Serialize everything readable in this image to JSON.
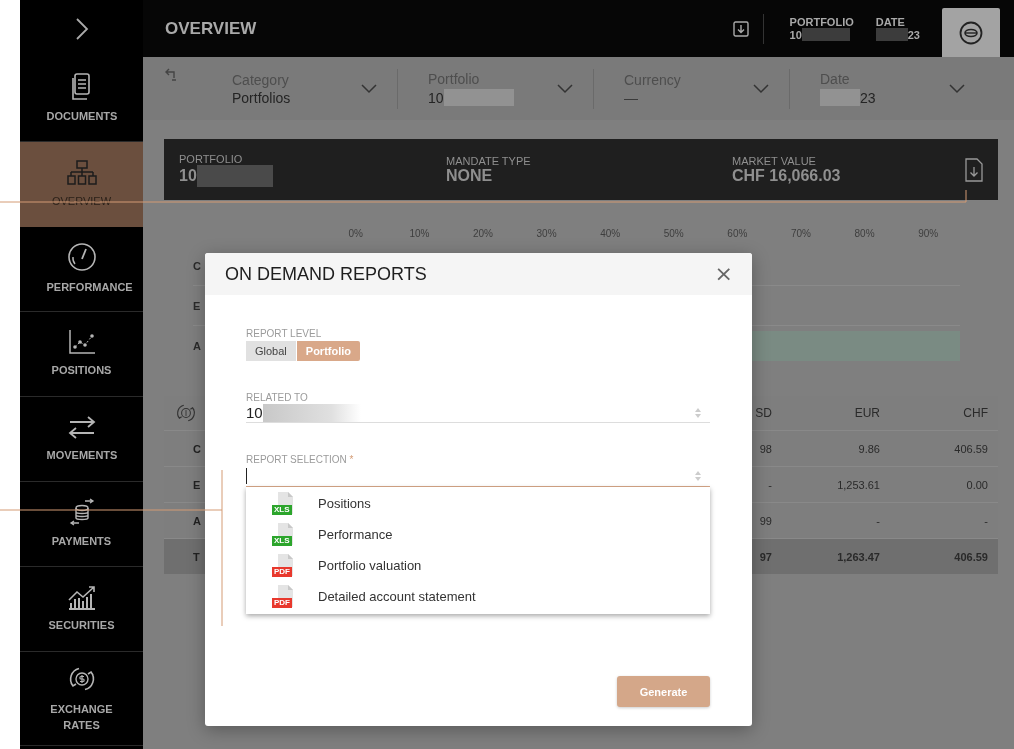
{
  "sidebar": {
    "items": [
      {
        "label": "DOCUMENTS",
        "selected": false
      },
      {
        "label": "OVERVIEW",
        "selected": true
      },
      {
        "label": "PERFORMANCE",
        "selected": false
      },
      {
        "label": "POSITIONS",
        "selected": false
      },
      {
        "label": "MOVEMENTS",
        "selected": false
      },
      {
        "label": "PAYMENTS",
        "selected": false
      },
      {
        "label": "SECURITIES",
        "selected": false
      },
      {
        "label": "EXCHANGE RATES",
        "selected": false
      }
    ]
  },
  "header": {
    "title": "OVERVIEW",
    "portfolio_label": "PORTFOLIO",
    "portfolio_value": "10",
    "date_label": "DATE",
    "date_value": "23"
  },
  "filters": [
    {
      "label": "Category",
      "value": "Portfolios",
      "redacted_before": false,
      "redacted_after": false
    },
    {
      "label": "Portfolio",
      "value": "10",
      "redacted_before": false,
      "redacted_after": true
    },
    {
      "label": "Currency",
      "placeholder": "—",
      "redacted_before": false,
      "redacted_after": false
    },
    {
      "label": "Date",
      "value": "23",
      "redacted_before": true,
      "redacted_after": false
    }
  ],
  "summary": {
    "portfolio_label": "PORTFOLIO",
    "portfolio_value": "10",
    "mandate_label": "MANDATE TYPE",
    "mandate_value": "NONE",
    "market_label": "MARKET VALUE",
    "market_value": "CHF 16,066.03"
  },
  "allocation": {
    "ticks": [
      "0%",
      "10%",
      "20%",
      "30%",
      "40%",
      "50%",
      "60%",
      "70%",
      "80%",
      "90%"
    ],
    "rows": [
      {
        "label": "C",
        "bar": false
      },
      {
        "label": "E",
        "bar": false
      },
      {
        "label": "A",
        "bar": true
      }
    ]
  },
  "table": {
    "columns": [
      "SD",
      "EUR",
      "CHF"
    ],
    "rows": [
      {
        "label": "C",
        "cells": [
          "98",
          "9.86",
          "406.59"
        ],
        "total": false
      },
      {
        "label": "E",
        "cells": [
          "-",
          "1,253.61",
          "0.00"
        ],
        "total": false
      },
      {
        "label": "A",
        "cells": [
          "99",
          "-",
          "-"
        ],
        "total": false
      },
      {
        "label": "T",
        "cells": [
          "97",
          "1,263.47",
          "406.59"
        ],
        "total": true
      }
    ]
  },
  "modal": {
    "title": "ON DEMAND REPORTS",
    "close": "×",
    "report_level": {
      "label": "REPORT LEVEL",
      "options": [
        {
          "label": "Global",
          "selected": false
        },
        {
          "label": "Portfolio",
          "selected": true
        }
      ]
    },
    "related_to": {
      "label": "RELATED TO",
      "value": "10"
    },
    "report_selection": {
      "label": "REPORT SELECTION",
      "required_mark": "*",
      "options": [
        {
          "label": "Positions",
          "kind": "xls",
          "badge": "XLS"
        },
        {
          "label": "Performance",
          "kind": "xls",
          "badge": "XLS"
        },
        {
          "label": "Portfolio valuation",
          "kind": "pdf",
          "badge": "PDF"
        },
        {
          "label": "Detailed account statement",
          "kind": "pdf",
          "badge": "PDF"
        }
      ]
    },
    "generate": "Generate"
  }
}
